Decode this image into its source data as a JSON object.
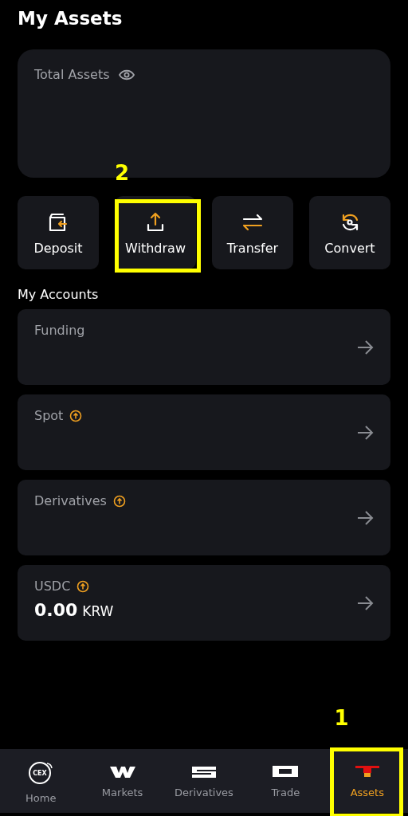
{
  "title": "My Assets",
  "total_card": {
    "label": "Total Assets"
  },
  "actions": [
    {
      "label": "Deposit",
      "kind": "deposit"
    },
    {
      "label": "Withdraw",
      "kind": "withdraw",
      "annotation": "2"
    },
    {
      "label": "Transfer",
      "kind": "transfer"
    },
    {
      "label": "Convert",
      "kind": "convert"
    }
  ],
  "accounts_heading": "My Accounts",
  "accounts": [
    {
      "name": "Funding",
      "upgrade": false
    },
    {
      "name": "Spot",
      "upgrade": true
    },
    {
      "name": "Derivatives",
      "upgrade": true
    },
    {
      "name": "USDC",
      "upgrade": true,
      "amount": "0.00",
      "currency": "KRW"
    }
  ],
  "nav": [
    {
      "label": "Home",
      "kind": "home",
      "icon_text": "CEX",
      "selected": false
    },
    {
      "label": "Markets",
      "kind": "markets",
      "selected": false
    },
    {
      "label": "Derivatives",
      "kind": "derivatives",
      "selected": false
    },
    {
      "label": "Trade",
      "kind": "trade",
      "selected": false
    },
    {
      "label": "Assets",
      "kind": "assets",
      "selected": true,
      "annotation": "1"
    }
  ]
}
